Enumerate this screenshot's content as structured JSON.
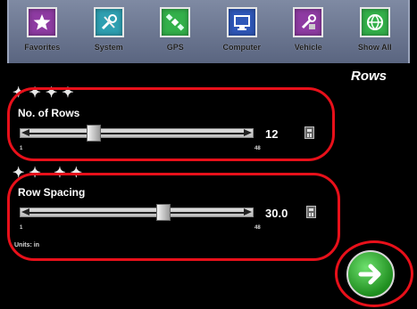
{
  "toolbar": {
    "items": [
      {
        "label": "Favorites",
        "icon": "star-icon",
        "color": "#8e3ba2"
      },
      {
        "label": "System",
        "icon": "tools-icon",
        "color": "#2e9fb1"
      },
      {
        "label": "GPS",
        "icon": "satellite-icon",
        "color": "#33b04a"
      },
      {
        "label": "Computer",
        "icon": "monitor-icon",
        "color": "#2f57b8"
      },
      {
        "label": "Vehicle",
        "icon": "wrench-icon",
        "color": "#8e3ba2"
      },
      {
        "label": "Show All",
        "icon": "globe-icon",
        "color": "#33b04a"
      }
    ]
  },
  "page": {
    "title": "Rows"
  },
  "rows_field": {
    "glyphs": "✦✦✦✦",
    "label": "No. of Rows",
    "value": "12",
    "min": "1",
    "max": "48",
    "level_fraction": 0.29
  },
  "spacing_field": {
    "glyphs": "✦✦ ✦✦",
    "label": "Row Spacing",
    "value": "30.0",
    "min": "1",
    "max": "48",
    "level_fraction": 0.6,
    "units": "Units: in"
  },
  "colors": {
    "highlight": "#e8101a",
    "toolbar_bg": "#6b7590",
    "next_button": "#2fa72f"
  },
  "next_button": {
    "icon": "arrow-right-icon"
  }
}
